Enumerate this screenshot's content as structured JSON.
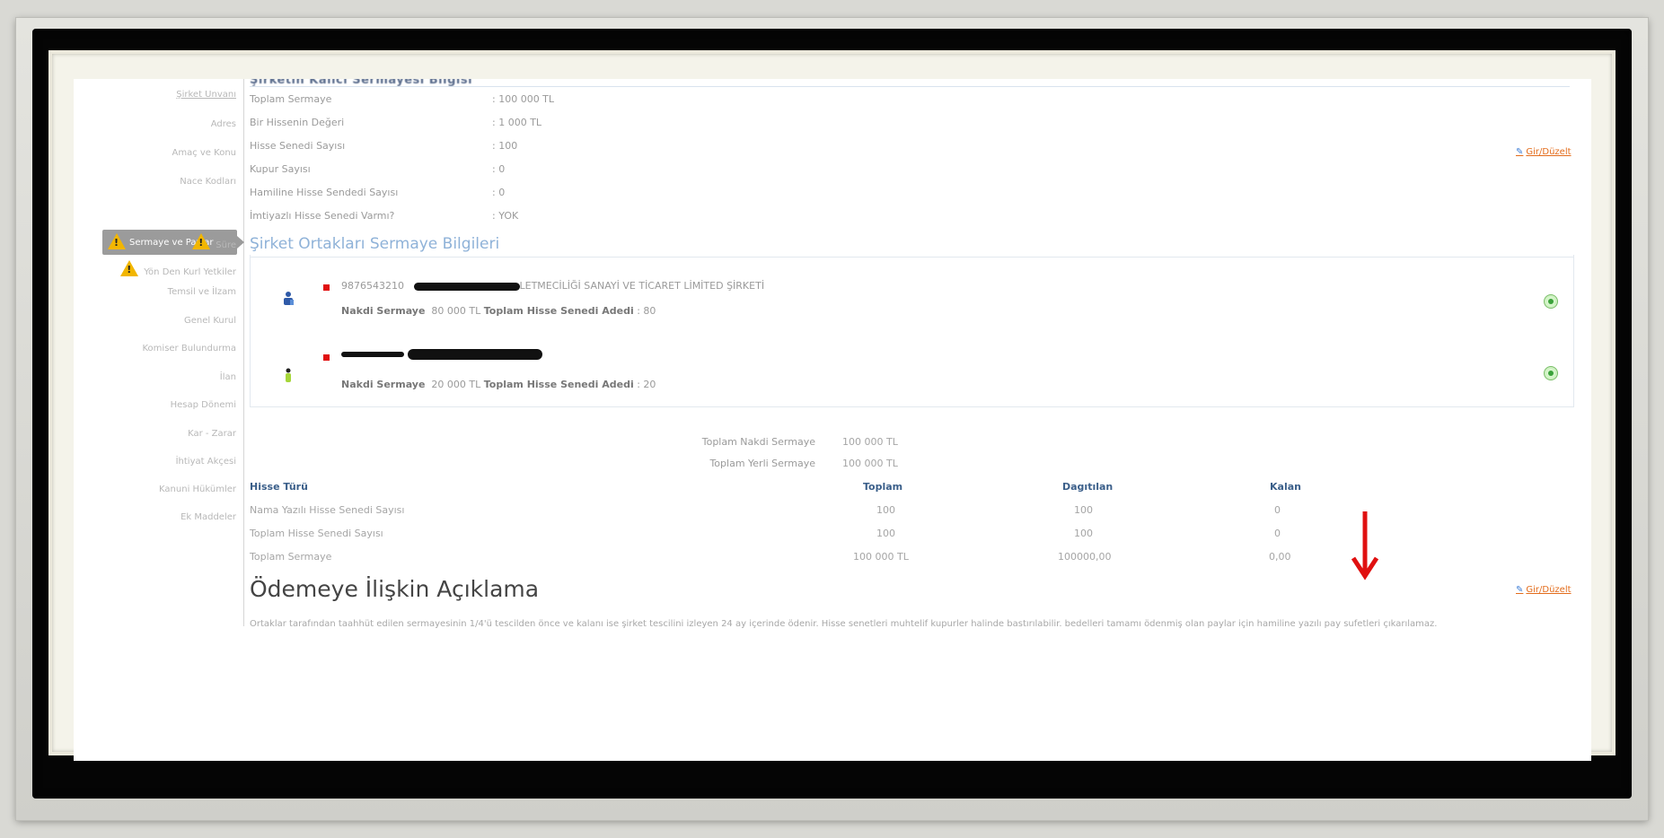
{
  "sidebar": {
    "items": [
      {
        "label": "Şirket Unvanı",
        "link": true
      },
      {
        "label": "Adres",
        "link": false
      },
      {
        "label": "Amaç ve Konu",
        "link": false
      },
      {
        "label": "Nace Kodları",
        "link": false
      },
      {
        "label": "Sermaye ve Paylar",
        "active": true
      },
      {
        "label": "Süre",
        "warning": true
      },
      {
        "label": "Yön Den Kurl Yetkiler",
        "warning": true
      },
      {
        "label": "Temsil ve İlzam",
        "link": false
      },
      {
        "label": "Genel Kurul",
        "link": false
      },
      {
        "label": "Komiser Bulundurma",
        "link": false
      },
      {
        "label": "İlan",
        "link": false
      },
      {
        "label": "Hesap Dönemi",
        "link": false
      },
      {
        "label": "Kar - Zarar",
        "link": false
      },
      {
        "label": "İhtiyat Akçesi",
        "link": false
      },
      {
        "label": "Kanuni Hükümler",
        "link": false
      },
      {
        "label": "Ek Maddeler",
        "link": false
      }
    ]
  },
  "capital_info": {
    "heading_cut": "Şirketin Kalıcı Sermayesi Bilgisi",
    "rows": [
      {
        "key": "Toplam Sermaye",
        "value": ": 100 000 TL"
      },
      {
        "key": "Bir Hissenin Değeri",
        "value": ": 1 000 TL"
      },
      {
        "key": "Hisse Senedi Sayısı",
        "value": ": 100"
      },
      {
        "key": "Kupur Sayısı",
        "value": ": 0"
      },
      {
        "key": "Hamiline Hisse Sendedi Sayısı",
        "value": ": 0"
      },
      {
        "key": "İmtiyazlı Hisse Senedi Varmı?",
        "value": ": YOK"
      }
    ],
    "edit_label": "Gir/Düzelt"
  },
  "partners": {
    "title": "Şirket Ortakları Sermaye Bilgileri",
    "items": [
      {
        "id": "9876543210",
        "name_visible": "LETMECİLİĞİ SANAYİ VE TİCARET LİMİTED ŞİRKETİ",
        "detail_label": "Nakdi Sermaye",
        "detail_value": "80 000 TL",
        "shares_label": "Toplam Hisse Senedi Adedi",
        "shares_value": ": 80"
      },
      {
        "id": "",
        "name_visible": "",
        "detail_label": "Nakdi Sermaye",
        "detail_value": "20 000 TL",
        "shares_label": "Toplam Hisse Senedi Adedi",
        "shares_value": ": 20"
      }
    ]
  },
  "totals": {
    "nakdi_label": "Toplam Nakdi Sermaye",
    "nakdi_value": "100 000 TL",
    "yerli_label": "Toplam Yerli Sermaye",
    "yerli_value": "100 000 TL"
  },
  "share_grid": {
    "headers": [
      "Hisse Türü",
      "Toplam",
      "Dagıtılan",
      "Kalan"
    ],
    "rows": [
      [
        "Nama Yazılı Hisse Senedi Sayısı",
        "100",
        "100",
        "0"
      ],
      [
        "Toplam Hisse Senedi Sayısı",
        "100",
        "100",
        "0"
      ],
      [
        "Toplam Sermaye",
        "100 000 TL",
        "100000,00",
        "0,00"
      ]
    ]
  },
  "payment": {
    "title": "Ödemeye İlişkin Açıklama",
    "edit_label": "Gir/Düzelt",
    "description": "Ortaklar tarafından taahhüt edilen sermayesinin 1/4'ü tescilden önce ve kalanı ise şirket tescilini izleyen 24 ay içerinde ödenir. Hisse senetleri muhtelif kupurler halinde bastırılabilir. bedelleri tamamı ödenmiş olan paylar için hamiline yazılı pay sufetleri çıkarılamaz."
  },
  "colors": {
    "edit_link": "#e36c1b",
    "arrow": "#e01010",
    "section_title": "#8fb2d8",
    "active_sidebar": "#9b9b9b"
  }
}
